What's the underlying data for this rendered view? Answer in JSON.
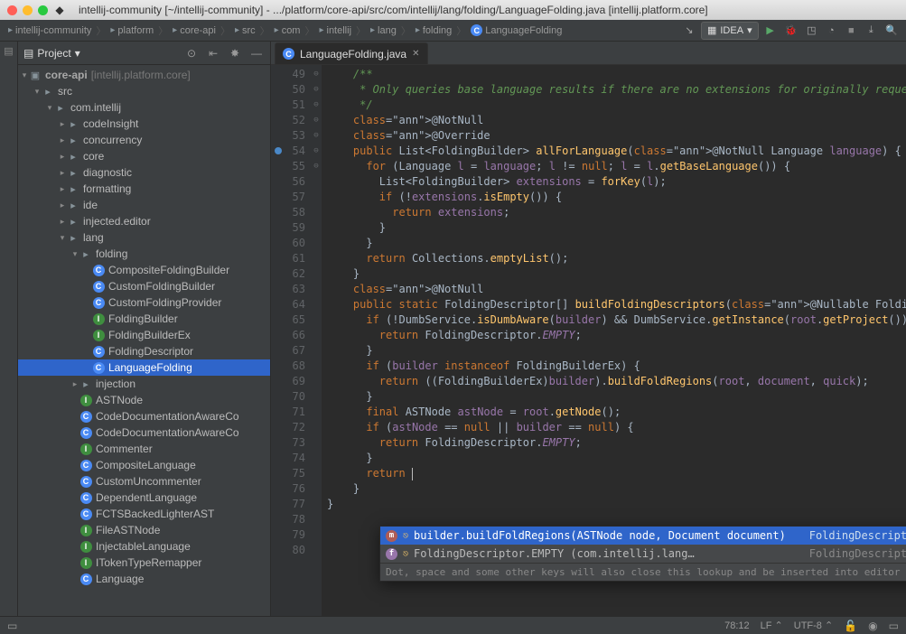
{
  "titlebar": {
    "title": "intellij-community [~/intellij-community] - .../platform/core-api/src/com/intellij/lang/folding/LanguageFolding.java [intellij.platform.core]"
  },
  "breadcrumb": [
    {
      "icon": "folder",
      "label": "intellij-community"
    },
    {
      "icon": "folder",
      "label": "platform"
    },
    {
      "icon": "folder",
      "label": "core-api"
    },
    {
      "icon": "folder",
      "label": "src"
    },
    {
      "icon": "folder",
      "label": "com"
    },
    {
      "icon": "folder",
      "label": "intellij"
    },
    {
      "icon": "folder",
      "label": "lang"
    },
    {
      "icon": "folder",
      "label": "folding"
    },
    {
      "icon": "class",
      "label": "LanguageFolding"
    }
  ],
  "run_config": {
    "label": "IDEA"
  },
  "project": {
    "header": "Project",
    "root": {
      "label": "core-api",
      "hint": "[intellij.platform.core]"
    },
    "tree": [
      {
        "d": 1,
        "a": "▾",
        "t": "folder",
        "l": "src"
      },
      {
        "d": 2,
        "a": "▾",
        "t": "folder",
        "l": "com.intellij"
      },
      {
        "d": 3,
        "a": "▸",
        "t": "folder",
        "l": "codeInsight"
      },
      {
        "d": 3,
        "a": "▸",
        "t": "folder",
        "l": "concurrency"
      },
      {
        "d": 3,
        "a": "▸",
        "t": "folder",
        "l": "core"
      },
      {
        "d": 3,
        "a": "▸",
        "t": "folder",
        "l": "diagnostic"
      },
      {
        "d": 3,
        "a": "▸",
        "t": "folder",
        "l": "formatting"
      },
      {
        "d": 3,
        "a": "▸",
        "t": "folder",
        "l": "ide"
      },
      {
        "d": 3,
        "a": "▸",
        "t": "folder",
        "l": "injected.editor"
      },
      {
        "d": 3,
        "a": "▾",
        "t": "folder",
        "l": "lang"
      },
      {
        "d": 4,
        "a": "▾",
        "t": "folder",
        "l": "folding"
      },
      {
        "d": 5,
        "a": "",
        "t": "class",
        "l": "CompositeFoldingBuilder"
      },
      {
        "d": 5,
        "a": "",
        "t": "class",
        "l": "CustomFoldingBuilder"
      },
      {
        "d": 5,
        "a": "",
        "t": "class",
        "l": "CustomFoldingProvider"
      },
      {
        "d": 5,
        "a": "",
        "t": "iface",
        "l": "FoldingBuilder"
      },
      {
        "d": 5,
        "a": "",
        "t": "iface",
        "l": "FoldingBuilderEx"
      },
      {
        "d": 5,
        "a": "",
        "t": "class",
        "l": "FoldingDescriptor"
      },
      {
        "d": 5,
        "a": "",
        "t": "class",
        "l": "LanguageFolding",
        "sel": true
      },
      {
        "d": 4,
        "a": "▸",
        "t": "folder",
        "l": "injection"
      },
      {
        "d": 4,
        "a": "",
        "t": "iface",
        "l": "ASTNode"
      },
      {
        "d": 4,
        "a": "",
        "t": "class",
        "l": "CodeDocumentationAwareCo"
      },
      {
        "d": 4,
        "a": "",
        "t": "class",
        "l": "CodeDocumentationAwareCo"
      },
      {
        "d": 4,
        "a": "",
        "t": "iface",
        "l": "Commenter"
      },
      {
        "d": 4,
        "a": "",
        "t": "class",
        "l": "CompositeLanguage"
      },
      {
        "d": 4,
        "a": "",
        "t": "class",
        "l": "CustomUncommenter"
      },
      {
        "d": 4,
        "a": "",
        "t": "class",
        "l": "DependentLanguage"
      },
      {
        "d": 4,
        "a": "",
        "t": "class",
        "l": "FCTSBackedLighterAST"
      },
      {
        "d": 4,
        "a": "",
        "t": "iface",
        "l": "FileASTNode"
      },
      {
        "d": 4,
        "a": "",
        "t": "iface",
        "l": "InjectableLanguage"
      },
      {
        "d": 4,
        "a": "",
        "t": "iface",
        "l": "ITokenTypeRemapper"
      },
      {
        "d": 4,
        "a": "",
        "t": "class",
        "l": "Language"
      }
    ]
  },
  "editor": {
    "tab": "LanguageFolding.java",
    "first_line": 49,
    "lines": [
      "    /**",
      "     * Only queries base language results if there are no extensions for originally requested ",
      "     */",
      "    @NotNull",
      "    @Override",
      "    public List<FoldingBuilder> allForLanguage(@NotNull Language language) {",
      "      for (Language l = language; l != null; l = l.getBaseLanguage()) {",
      "        List<FoldingBuilder> extensions = forKey(l);",
      "        if (!extensions.isEmpty()) {",
      "          return extensions;",
      "        }",
      "      }",
      "      return Collections.emptyList();",
      "    }",
      "",
      "    @NotNull",
      "    public static FoldingDescriptor[] buildFoldingDescriptors(@Nullable FoldingBuilder builder",
      "      if (!DumbService.isDumbAware(builder) && DumbService.getInstance(root.getProject()).isDu",
      "        return FoldingDescriptor.EMPTY;",
      "      }",
      "",
      "      if (builder instanceof FoldingBuilderEx) {",
      "        return ((FoldingBuilderEx)builder).buildFoldRegions(root, document, quick);",
      "      }",
      "      final ASTNode astNode = root.getNode();",
      "      if (astNode == null || builder == null) {",
      "        return FoldingDescriptor.EMPTY;",
      "      }",
      "",
      "      return ",
      "    }",
      "}"
    ],
    "fold": [
      "",
      "",
      "",
      "",
      "",
      "⊖",
      "⊖",
      "",
      "⊖",
      "",
      "",
      "",
      "",
      "",
      "",
      "",
      "⊖",
      "⊖",
      "",
      "",
      "",
      "⊖",
      "",
      "",
      "",
      "⊖",
      "",
      "",
      "",
      "",
      "",
      ""
    ],
    "breakpoint_line": 54
  },
  "completion": {
    "rows": [
      {
        "sel": true,
        "kind": "m",
        "text": "builder.buildFoldRegions(ASTNode node, Document document)",
        "ret": "FoldingDescriptor[]"
      },
      {
        "sel": false,
        "kind": "f",
        "text": "FoldingDescriptor.EMPTY (com.intellij.lang…",
        "ret": "FoldingDescriptor[]"
      }
    ],
    "hint": "Dot, space and some other keys will also close this lookup and be inserted into editor",
    "hint_link": ">>"
  },
  "status": {
    "pos": "78:12",
    "lf": "LF",
    "enc": "UTF-8"
  }
}
